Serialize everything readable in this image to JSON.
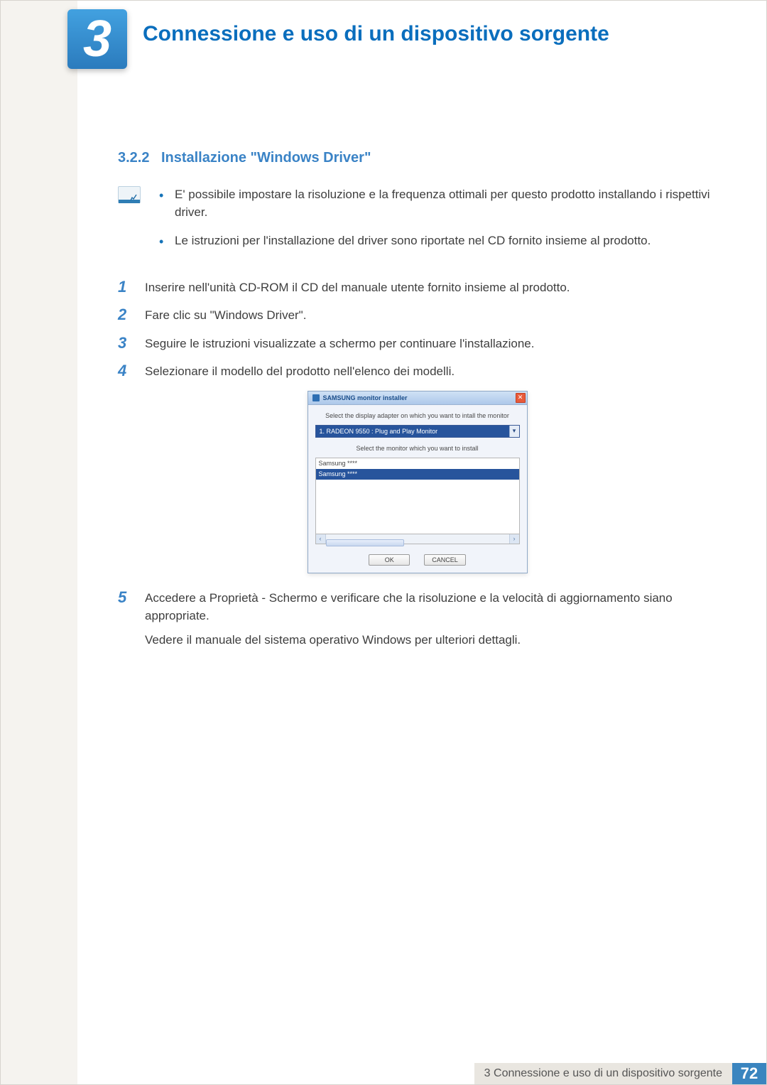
{
  "chapter": {
    "number": "3",
    "title": "Connessione e uso di un dispositivo sorgente"
  },
  "section": {
    "number": "3.2.2",
    "title": "Installazione \"Windows Driver\""
  },
  "notes": [
    "E' possibile impostare la risoluzione e la frequenza ottimali per questo prodotto installando i rispettivi driver.",
    "Le istruzioni per l'installazione del driver sono riportate nel CD fornito insieme al prodotto."
  ],
  "steps": [
    {
      "n": "1",
      "text": "Inserire nell'unità CD-ROM il CD del manuale utente fornito insieme al prodotto."
    },
    {
      "n": "2",
      "text": "Fare clic su \"Windows Driver\"."
    },
    {
      "n": "3",
      "text": "Seguire le istruzioni visualizzate a schermo per continuare l'installazione."
    },
    {
      "n": "4",
      "text": "Selezionare il modello del prodotto nell'elenco dei modelli."
    },
    {
      "n": "5",
      "text": "Accedere a Proprietà - Schermo e verificare che la risoluzione e la velocità di aggiornamento siano appropriate.",
      "extra": "Vedere il manuale del sistema operativo Windows per ulteriori dettagli."
    }
  ],
  "installer": {
    "title": "SAMSUNG monitor installer",
    "label_adapter": "Select the display adapter on which you want to intall the monitor",
    "adapter_selected": "1. RADEON 9550 : Plug and Play Monitor",
    "label_monitor": "Select the monitor which you want to install",
    "models": [
      "Samsung ****",
      "Samsung ****"
    ],
    "ok": "OK",
    "cancel": "CANCEL"
  },
  "footer": {
    "label": "3 Connessione e uso di un dispositivo sorgente",
    "page": "72"
  }
}
